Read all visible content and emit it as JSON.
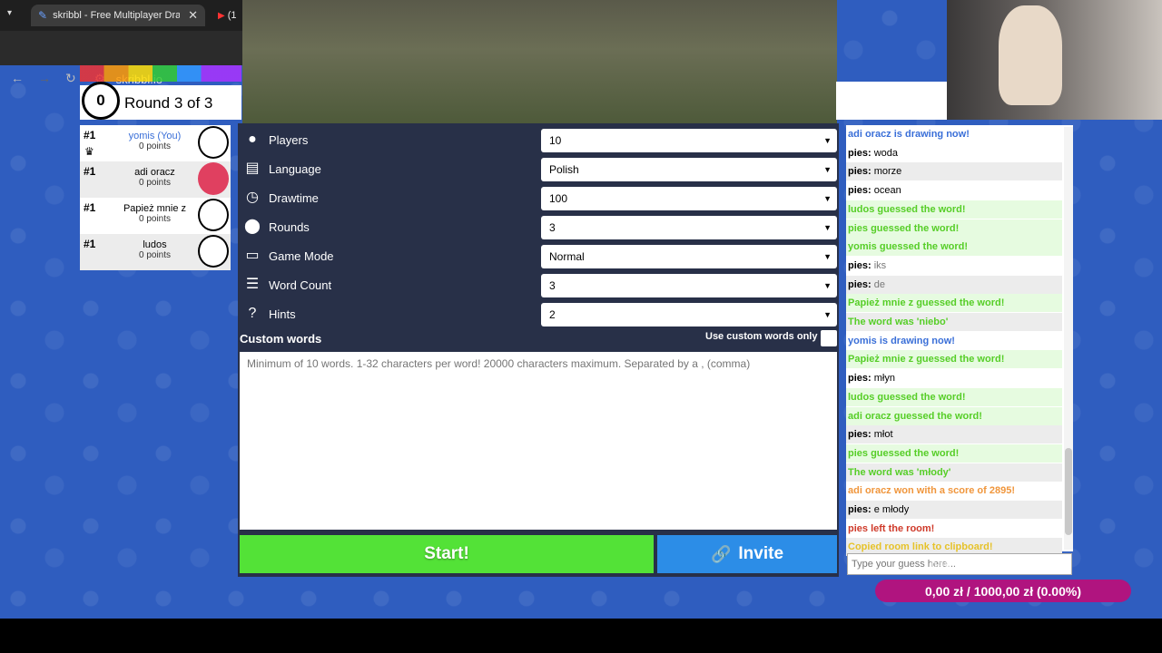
{
  "browser": {
    "tab_title": "skribbl - Free Multiplayer Drawing & Guessing Game",
    "tab2_label": "(1",
    "url": "skribbl.io"
  },
  "round": {
    "timer": "0",
    "label": "Round 3 of 3"
  },
  "players": [
    {
      "rank": "#1",
      "name": "yomis (You)",
      "points": "0 points",
      "is_you": true,
      "avatar_color": "#ffffff"
    },
    {
      "rank": "#1",
      "name": "adi oracz",
      "points": "0 points",
      "is_you": false,
      "avatar_color": "#e04060"
    },
    {
      "rank": "#1",
      "name": "Papież mnie z",
      "points": "0 points",
      "is_you": false,
      "avatar_color": "#ffffff"
    },
    {
      "rank": "#1",
      "name": "ludos",
      "points": "0 points",
      "is_you": false,
      "avatar_color": "#ffffff"
    }
  ],
  "settings": [
    {
      "label": "Players",
      "value": "10",
      "icon": "player-icon"
    },
    {
      "label": "Language",
      "value": "Polish",
      "icon": "language-icon"
    },
    {
      "label": "Drawtime",
      "value": "100",
      "icon": "clock-icon"
    },
    {
      "label": "Rounds",
      "value": "3",
      "icon": "rounds-icon"
    },
    {
      "label": "Game Mode",
      "value": "Normal",
      "icon": "gamemode-icon"
    },
    {
      "label": "Word Count",
      "value": "3",
      "icon": "wordcount-icon"
    },
    {
      "label": "Hints",
      "value": "2",
      "icon": "hints-icon"
    }
  ],
  "custom_words": {
    "label": "Custom words",
    "only_label": "Use custom words only",
    "placeholder": "Minimum of 10 words. 1-32 characters per word! 20000 characters maximum. Separated by a , (comma)"
  },
  "buttons": {
    "start": "Start!",
    "invite": "Invite"
  },
  "chat": [
    {
      "who": "",
      "text": "adi oracz is drawing now!",
      "color": "#3a6fd8",
      "bg": ""
    },
    {
      "who": "pies: ",
      "text": "woda",
      "color": "#000000",
      "bg": ""
    },
    {
      "who": "pies: ",
      "text": "morze",
      "color": "#000000",
      "bg": "gray"
    },
    {
      "who": "pies: ",
      "text": "ocean",
      "color": "#000000",
      "bg": ""
    },
    {
      "who": "",
      "text": "ludos guessed the word!",
      "color": "#56ce27",
      "bg": "green"
    },
    {
      "who": "",
      "text": "pies guessed the word!",
      "color": "#56ce27",
      "bg": "green"
    },
    {
      "who": "",
      "text": "yomis guessed the word!",
      "color": "#56ce27",
      "bg": "green"
    },
    {
      "who": "pies: ",
      "text": "iks",
      "color": "#777777",
      "bg": ""
    },
    {
      "who": "pies: ",
      "text": "de",
      "color": "#777777",
      "bg": "gray"
    },
    {
      "who": "",
      "text": "Papież mnie z guessed the word!",
      "color": "#56ce27",
      "bg": "green"
    },
    {
      "who": "",
      "text": "The word was 'niebo'",
      "color": "#56ce27",
      "bg": "gray"
    },
    {
      "who": "",
      "text": "yomis is drawing now!",
      "color": "#3a6fd8",
      "bg": ""
    },
    {
      "who": "",
      "text": "Papież mnie z guessed the word!",
      "color": "#56ce27",
      "bg": "green"
    },
    {
      "who": "pies: ",
      "text": "młyn",
      "color": "#000000",
      "bg": ""
    },
    {
      "who": "",
      "text": "ludos guessed the word!",
      "color": "#56ce27",
      "bg": "green"
    },
    {
      "who": "",
      "text": "adi oracz guessed the word!",
      "color": "#56ce27",
      "bg": "green"
    },
    {
      "who": "pies: ",
      "text": "młot",
      "color": "#000000",
      "bg": "gray"
    },
    {
      "who": "",
      "text": "pies guessed the word!",
      "color": "#56ce27",
      "bg": "green"
    },
    {
      "who": "",
      "text": "The word was 'młody'",
      "color": "#56ce27",
      "bg": "gray"
    },
    {
      "who": "",
      "text": "adi oracz won with a score of 2895!",
      "color": "#f0963c",
      "bg": ""
    },
    {
      "who": "pies: ",
      "text": "e młody",
      "color": "#000000",
      "bg": "gray"
    },
    {
      "who": "",
      "text": "pies left the room!",
      "color": "#cf3a2a",
      "bg": ""
    },
    {
      "who": "",
      "text": "Copied room link to clipboard!",
      "color": "#e6c229",
      "bg": "gray"
    }
  ],
  "guess_placeholder": "Type your guess here...",
  "overlay_text": "najedzenie",
  "donation": {
    "text": "0,00 zł / 1000,00 zł (0.00%)",
    "progress": 0.0
  }
}
